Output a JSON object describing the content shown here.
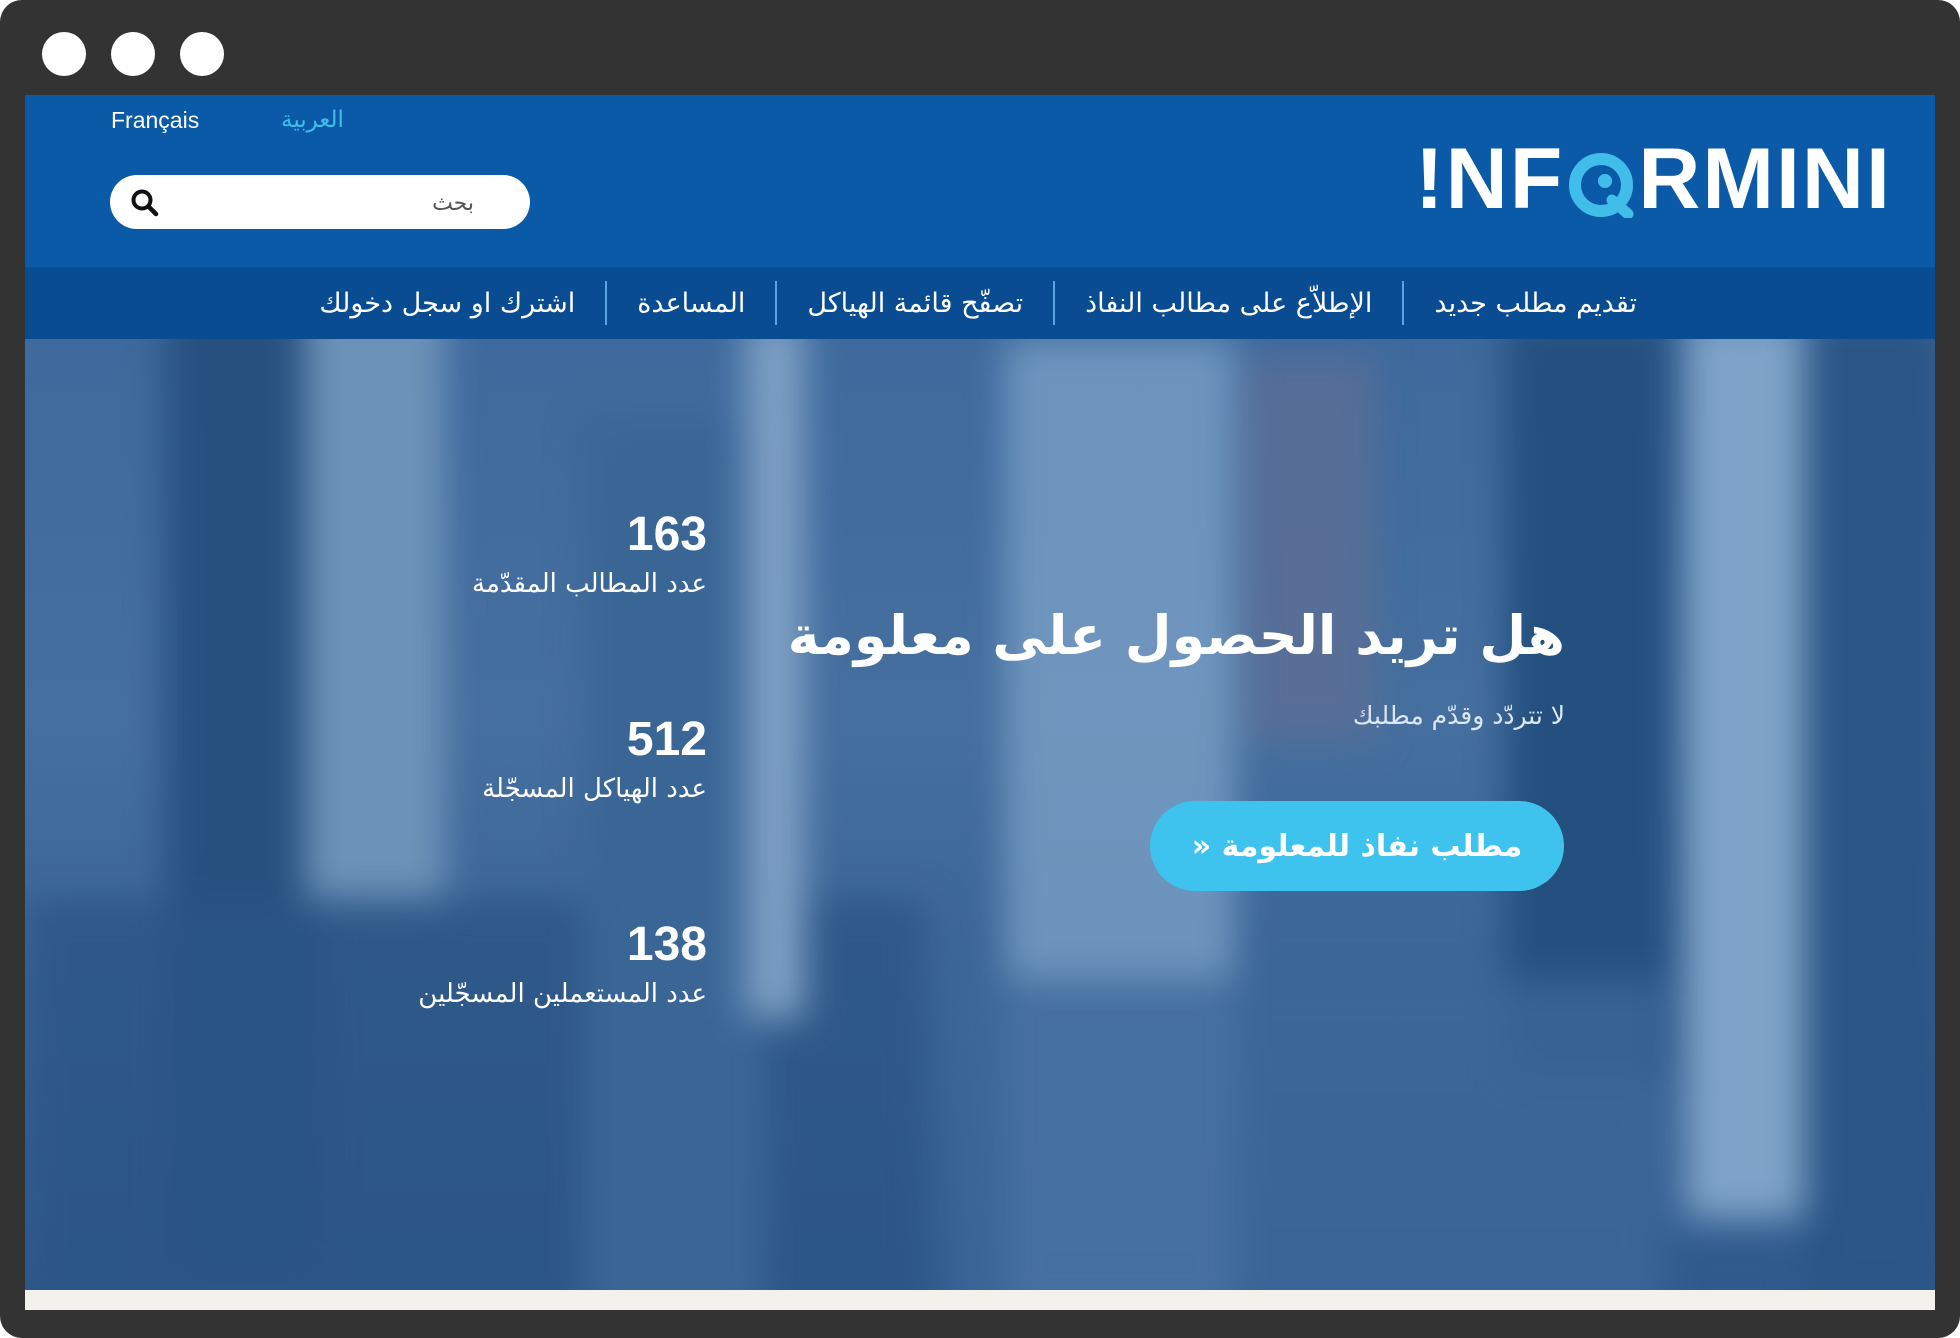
{
  "window": {
    "controls": [
      "dot-1",
      "dot-2",
      "dot-3"
    ]
  },
  "header": {
    "languages": {
      "french": "Français",
      "arabic": "العربية"
    },
    "search": {
      "placeholder": "بحث",
      "icon": "search-icon"
    },
    "logo": {
      "text_before": "!NF",
      "text_after": "RMINI",
      "accent": "#41bde9"
    }
  },
  "nav": {
    "items": [
      {
        "label": "تقديم مطلب جديد"
      },
      {
        "label": "الإطلاّع على مطالب النفاذ"
      },
      {
        "label": "تصفّح قائمة الهياكل"
      },
      {
        "label": "المساعدة"
      },
      {
        "label": "اشترك او سجل دخولك"
      }
    ]
  },
  "hero": {
    "headline": "هل تريد الحصول على معلومة",
    "subline": "لا تتردّد وقدّم مطلبك",
    "cta_label": "مطلب نفاذ للمعلومة «",
    "cta_color": "#3ec3ee"
  },
  "stats": [
    {
      "value": "163",
      "label": "عدد المطالب المقدّمة"
    },
    {
      "value": "512",
      "label": "عدد الهياكل المسجّلة"
    },
    {
      "value": "138",
      "label": "عدد المستعملين المسجّلين"
    }
  ],
  "colors": {
    "header_bg": "#0b5aa8",
    "nav_bg": "#0a4c91",
    "frame": "#333333"
  }
}
